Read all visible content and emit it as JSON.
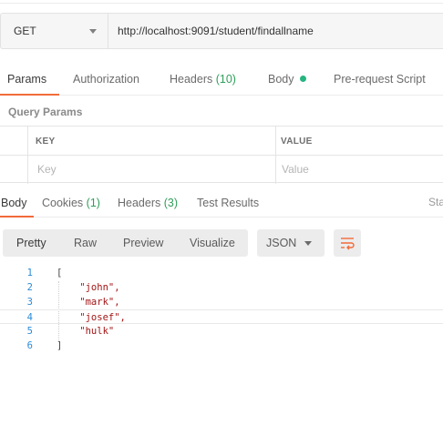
{
  "request": {
    "method": "GET",
    "url": "http://localhost:9091/student/findallname"
  },
  "request_tabs": {
    "params": "Params",
    "authorization": "Authorization",
    "headers": "Headers",
    "headers_count": "(10)",
    "body": "Body",
    "prerequest": "Pre-request Script"
  },
  "query_params": {
    "title": "Query Params",
    "key_header": "KEY",
    "value_header": "VALUE",
    "key_placeholder": "Key",
    "value_placeholder": "Value"
  },
  "response_tabs": {
    "body": "Body",
    "cookies": "Cookies",
    "cookies_count": "(1)",
    "headers": "Headers",
    "headers_count": "(3)",
    "test_results": "Test Results",
    "status_partial": "Sta"
  },
  "response_view": {
    "pretty": "Pretty",
    "raw": "Raw",
    "preview": "Preview",
    "visualize": "Visualize",
    "format": "JSON"
  },
  "response_body": {
    "line_numbers": [
      "1",
      "2",
      "3",
      "4",
      "5",
      "6"
    ],
    "lines": [
      "[",
      "    \"john\",",
      "    \"mark\",",
      "    \"josef\",",
      "    \"hulk\"",
      "]"
    ]
  },
  "colors": {
    "accent": "#f26b3a",
    "count_green": "#2e9e5a",
    "body_dot": "#26b47f",
    "line_number_blue": "#2a8bd8",
    "string_red": "#a31515"
  },
  "icons": {
    "method_dropdown": "chevron-down-icon",
    "format_dropdown": "chevron-down-icon",
    "wrap": "wrap-lines-icon"
  }
}
